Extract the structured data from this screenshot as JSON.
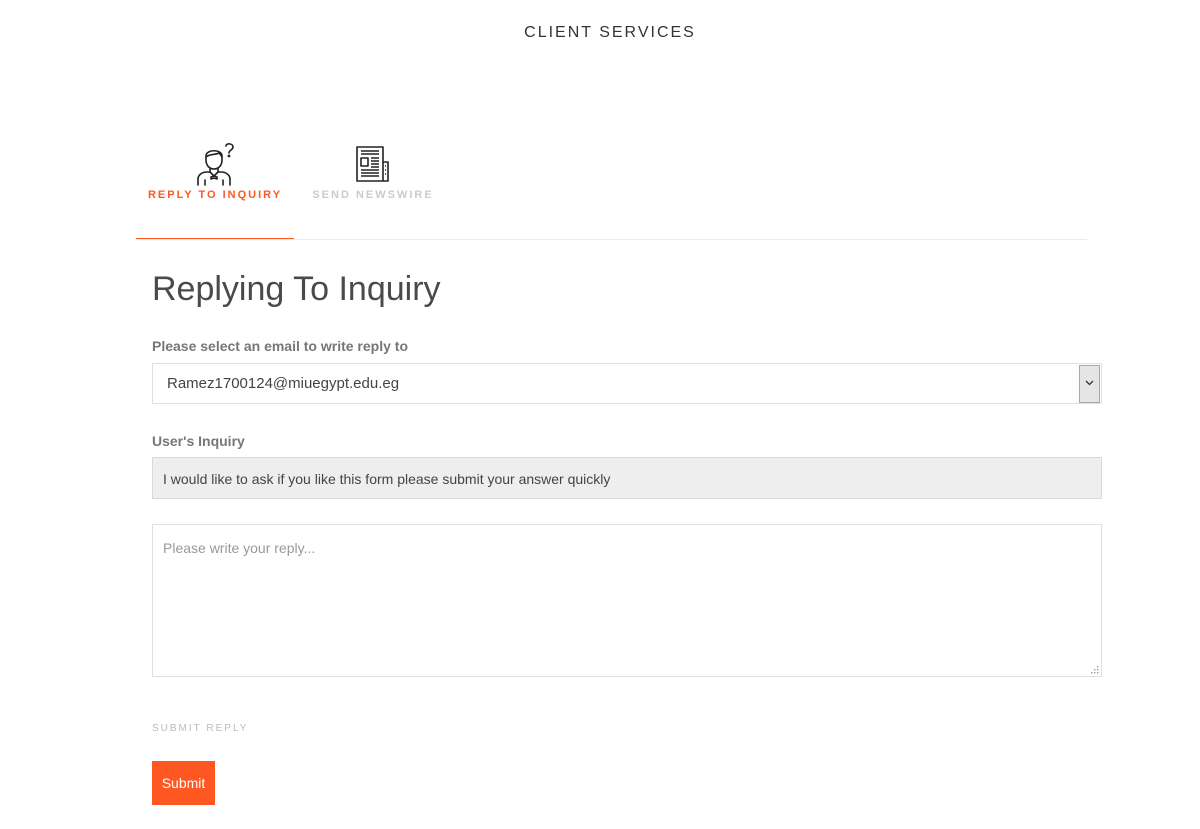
{
  "header": {
    "title": "CLIENT SERVICES"
  },
  "tabs": [
    {
      "label": "REPLY TO INQUIRY",
      "icon": "person-question-icon",
      "active": true
    },
    {
      "label": "SEND NEWSWIRE",
      "icon": "newspaper-icon",
      "active": false
    }
  ],
  "form": {
    "heading": "Replying To Inquiry",
    "email_select": {
      "label": "Please select an email to write reply to",
      "value": "Ramez1700124@miuegypt.edu.eg"
    },
    "inquiry": {
      "label": "User's Inquiry",
      "value": "I would like to ask if you like this form please submit your answer quickly"
    },
    "reply": {
      "placeholder": "Please write your reply...",
      "value": ""
    },
    "submit_caption": "SUBMIT REPLY",
    "submit_label": "Submit"
  },
  "colors": {
    "accent": "#ff5722",
    "inactive_tab": "#cccccc",
    "readonly_background": "#eeeeee"
  }
}
